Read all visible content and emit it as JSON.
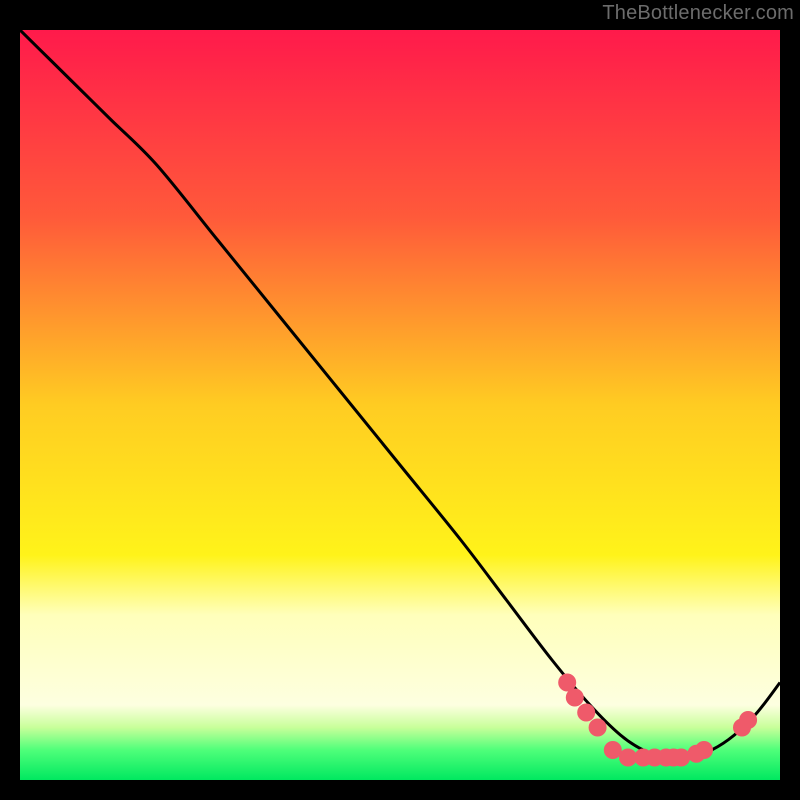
{
  "attribution": "TheBottlenecker.com",
  "chart_data": {
    "type": "line",
    "title": "",
    "xlabel": "",
    "ylabel": "",
    "xlim": [
      0,
      100
    ],
    "ylim": [
      0,
      100
    ],
    "background_gradient": {
      "stops": [
        {
          "offset": 0.0,
          "color": "#ff1a4b"
        },
        {
          "offset": 0.25,
          "color": "#ff5a3a"
        },
        {
          "offset": 0.5,
          "color": "#ffcc22"
        },
        {
          "offset": 0.7,
          "color": "#fff31a"
        },
        {
          "offset": 0.78,
          "color": "#ffffbb"
        },
        {
          "offset": 0.9,
          "color": "#fdffe0"
        },
        {
          "offset": 0.93,
          "color": "#c8ff9a"
        },
        {
          "offset": 0.96,
          "color": "#4fff7a"
        },
        {
          "offset": 1.0,
          "color": "#00e860"
        }
      ]
    },
    "series": [
      {
        "name": "curve",
        "color": "#000000",
        "x": [
          0,
          4,
          8,
          12,
          18,
          26,
          34,
          42,
          50,
          58,
          64,
          70,
          75,
          79,
          82,
          85,
          88,
          91,
          94,
          97,
          100
        ],
        "y": [
          100,
          96,
          92,
          88,
          82,
          72,
          62,
          52,
          42,
          32,
          24,
          16,
          10,
          6,
          4,
          3,
          3,
          4,
          6,
          9,
          13
        ]
      }
    ],
    "markers": [
      {
        "x": 72,
        "y": 13
      },
      {
        "x": 73,
        "y": 11
      },
      {
        "x": 74.5,
        "y": 9
      },
      {
        "x": 76,
        "y": 7
      },
      {
        "x": 78,
        "y": 4
      },
      {
        "x": 80,
        "y": 3
      },
      {
        "x": 82,
        "y": 3
      },
      {
        "x": 83.5,
        "y": 3
      },
      {
        "x": 85,
        "y": 3
      },
      {
        "x": 86,
        "y": 3
      },
      {
        "x": 87,
        "y": 3
      },
      {
        "x": 89,
        "y": 3.5
      },
      {
        "x": 90,
        "y": 4
      },
      {
        "x": 95,
        "y": 7
      },
      {
        "x": 95.8,
        "y": 8
      }
    ],
    "marker_style": {
      "color": "#ef5a6a",
      "radius": 9
    }
  }
}
